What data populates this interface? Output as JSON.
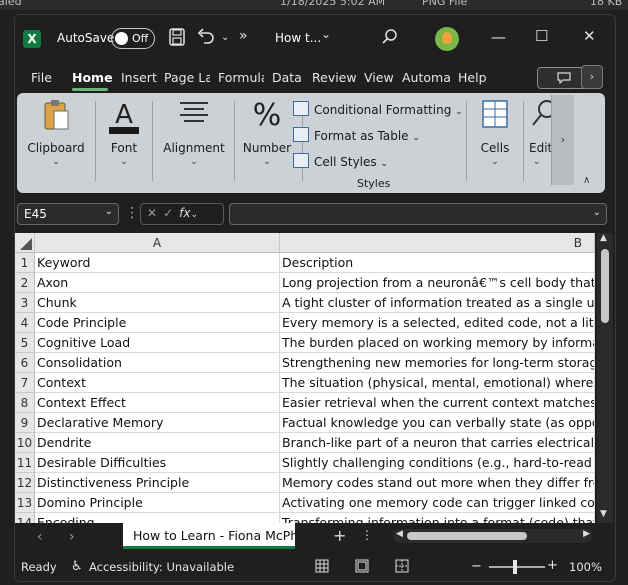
{
  "top_strip": {
    "left": "aled",
    "mid1": "1/18/2025 5:02 AM",
    "mid2": "PNG File",
    "right": "18 KB"
  },
  "titlebar": {
    "app_letter": "X",
    "autosave_label": "AutoSave",
    "toggle_state": "Off",
    "save_icon": "save-icon",
    "undo_icon": "undo-icon",
    "more_label": "»",
    "doc_title": "How t...",
    "doc_chevron": "⌄",
    "search_icon": "search-icon",
    "minimize": "—",
    "maximize": "☐",
    "close": "✕"
  },
  "ribbon_tabs": [
    "File",
    "Home",
    "Insert",
    "Page La",
    "Formula",
    "Data",
    "Review",
    "View",
    "Automa",
    "Help"
  ],
  "ribbon_tabs_more": "›",
  "ribbon": {
    "clipboard": "Clipboard",
    "font": "Font",
    "alignment": "Alignment",
    "number": "Number",
    "conditional_formatting": "Conditional Formatting",
    "format_as_table": "Format as Table",
    "cell_styles": "Cell Styles",
    "styles_group": "Styles",
    "cells": "Cells",
    "editing": "Editi",
    "scroll": "›",
    "collapse": "∧"
  },
  "formula_bar": {
    "name_box": "E45",
    "fx": "fx",
    "formula": ""
  },
  "grid": {
    "col_headers": [
      "A",
      "B"
    ],
    "rows": [
      {
        "n": "1",
        "a": "Keyword",
        "b": "Description"
      },
      {
        "n": "2",
        "a": "Axon",
        "b": "Long projection from a neuronâ€™s cell body that se"
      },
      {
        "n": "3",
        "a": "Chunk",
        "b": "A tight cluster of information treated as a single uni"
      },
      {
        "n": "4",
        "a": "Code Principle",
        "b": "Every memory is a selected, edited code, not a litera"
      },
      {
        "n": "5",
        "a": "Cognitive Load",
        "b": "The burden placed on working memory by informat"
      },
      {
        "n": "6",
        "a": "Consolidation",
        "b": "Strengthening new memories for long-term storage"
      },
      {
        "n": "7",
        "a": "Context",
        "b": "The situation (physical, mental, emotional) where l"
      },
      {
        "n": "8",
        "a": "Context Effect",
        "b": "Easier retrieval when the current context matches th"
      },
      {
        "n": "9",
        "a": "Declarative Memory",
        "b": "Factual knowledge you can verbally state (as oppos"
      },
      {
        "n": "10",
        "a": "Dendrite",
        "b": "Branch-like part of a neuron that carries electrical s"
      },
      {
        "n": "11",
        "a": "Desirable Difficulties",
        "b": "Slightly challenging conditions (e.g., hard-to-read f"
      },
      {
        "n": "12",
        "a": "Distinctiveness Principle",
        "b": "Memory codes stand out more when they differ from"
      },
      {
        "n": "13",
        "a": "Domino Principle",
        "b": "Activating one memory code can trigger linked code"
      },
      {
        "n": "14",
        "a": "Encoding",
        "b": "Transforming information into a format (code) that"
      }
    ]
  },
  "sheet_bar": {
    "prev": "‹",
    "next": "›",
    "sheet_name": "How to Learn - Fiona McPherson",
    "add": "+",
    "more": "⋮"
  },
  "status": {
    "ready": "Ready",
    "accessibility": "Accessibility: Unavailable",
    "zoom_minus": "−",
    "zoom_plus": "+",
    "zoom": "100%"
  }
}
